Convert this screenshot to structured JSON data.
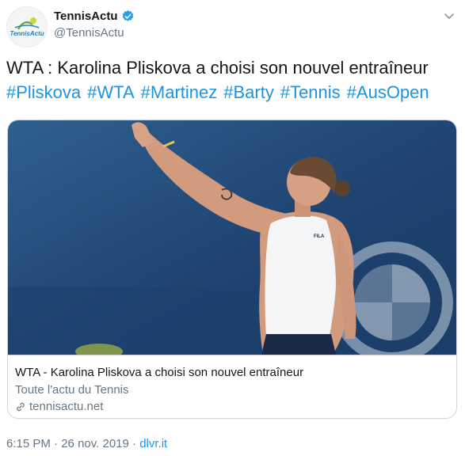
{
  "author": {
    "display_name": "TennisActu",
    "handle": "@TennisActu",
    "avatar_logo_text": "TennisActu",
    "verified": true
  },
  "tweet": {
    "text": "WTA : Karolina Pliskova a choisi son nouvel entraîneur",
    "hashtags": [
      "#Pliskova",
      "#WTA",
      "#Martinez",
      "#Barty",
      "#Tennis",
      "#AusOpen"
    ]
  },
  "card": {
    "title": "WTA - Karolina Pliskova a choisi son nouvel entraîneur",
    "description": "Toute l'actu du Tennis",
    "domain": "tennisactu.net",
    "image_alt_icon": "tennis-player-photo"
  },
  "meta": {
    "time": "6:15 PM",
    "separator": " · ",
    "date": "26 nov. 2019",
    "source": "dlvr.it"
  },
  "colors": {
    "link": "#1b95e0",
    "secondary": "#657786",
    "border": "#ccd6dd",
    "verified": "#1da1f2"
  }
}
